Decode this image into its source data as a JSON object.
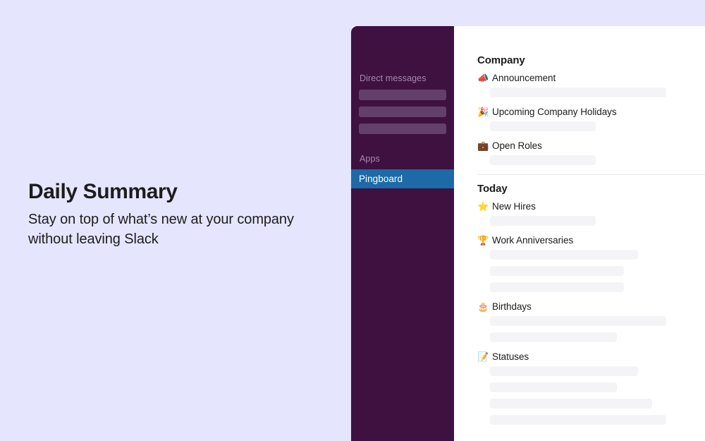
{
  "promo": {
    "title": "Daily Summary",
    "subtitle": "Stay on top of what’s new at your company without leaving Slack"
  },
  "colors": {
    "promo_background": "#e5e6fd",
    "sidebar_background": "#3e1140",
    "sidebar_placeholder": "#63406b",
    "sidebar_selected": "#1c6aa8",
    "content_background": "#ffffff",
    "placeholder_bar": "#f4f4f6",
    "divider": "#e8e8e8",
    "text_primary": "#1d1c1d",
    "sidebar_label": "#a888ad"
  },
  "sidebar": {
    "direct_messages_label": "Direct messages",
    "dm_placeholders": [
      124,
      124,
      124
    ],
    "apps_label": "Apps",
    "apps": [
      {
        "name": "Pingboard",
        "selected": true
      }
    ]
  },
  "content": {
    "sections": [
      {
        "heading": "Company",
        "items": [
          {
            "emoji": "📣",
            "icon_name": "megaphone-icon",
            "label": "Announcement",
            "bars": [
              250
            ]
          },
          {
            "emoji": "🎉",
            "icon_name": "party-popper-icon",
            "label": "Upcoming Company Holidays",
            "bars": [
              150
            ]
          },
          {
            "emoji": "💼",
            "icon_name": "briefcase-icon",
            "label": "Open Roles",
            "bars": [
              150
            ]
          }
        ]
      },
      {
        "heading": "Today",
        "items": [
          {
            "emoji": "⭐",
            "icon_name": "star-icon",
            "label": "New Hires",
            "bars": [
              150
            ]
          },
          {
            "emoji": "🏆",
            "icon_name": "trophy-icon",
            "label": "Work Anniversaries",
            "bars": [
              210,
              190,
              190
            ]
          },
          {
            "emoji": "🎂",
            "icon_name": "birthday-cake-icon",
            "label": "Birthdays",
            "bars": [
              250,
              180
            ]
          },
          {
            "emoji": "📝",
            "icon_name": "memo-icon",
            "label": "Statuses",
            "bars": [
              210,
              180,
              230,
              250
            ]
          }
        ]
      }
    ]
  }
}
